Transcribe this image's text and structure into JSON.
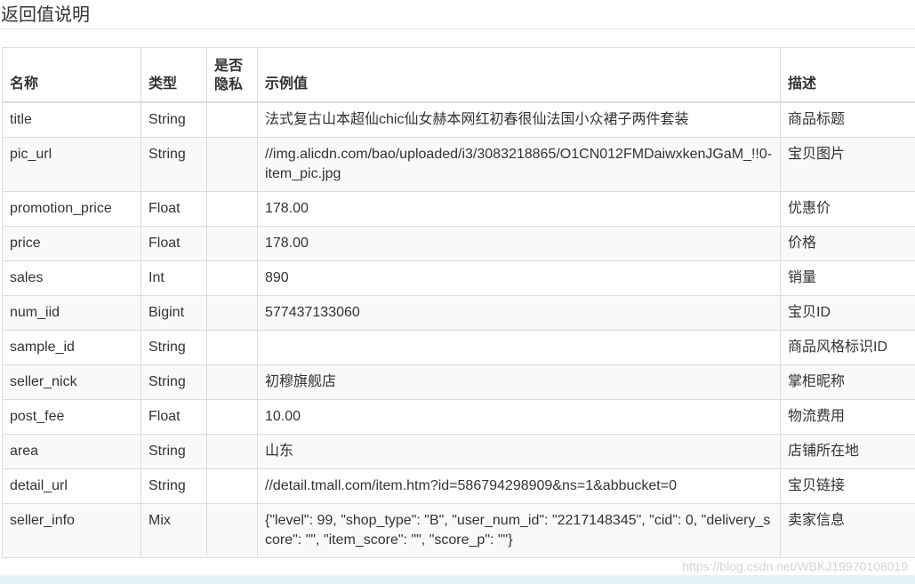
{
  "section_title": "返回值说明",
  "headers": [
    "名称",
    "类型",
    "是否隐私",
    "示例值",
    "描述"
  ],
  "rows": [
    {
      "name": "title",
      "type": "String",
      "privacy": "",
      "example": "法式复古山本超仙chic仙女赫本网红初春很仙法国小众裙子两件套装",
      "desc": "商品标题"
    },
    {
      "name": "pic_url",
      "type": "String",
      "privacy": "",
      "example": "//img.alicdn.com/bao/uploaded/i3/3083218865/O1CN012FMDaiwxkenJGaM_!!0-item_pic.jpg",
      "desc": "宝贝图片"
    },
    {
      "name": "promotion_price",
      "type": "Float",
      "privacy": "",
      "example": "178.00",
      "desc": "优惠价"
    },
    {
      "name": "price",
      "type": "Float",
      "privacy": "",
      "example": "178.00",
      "desc": "价格"
    },
    {
      "name": "sales",
      "type": "Int",
      "privacy": "",
      "example": "890",
      "desc": "销量"
    },
    {
      "name": "num_iid",
      "type": "Bigint",
      "privacy": "",
      "example": "577437133060",
      "desc": "宝贝ID"
    },
    {
      "name": "sample_id",
      "type": "String",
      "privacy": "",
      "example": "",
      "desc": "商品风格标识ID"
    },
    {
      "name": "seller_nick",
      "type": "String",
      "privacy": "",
      "example": "初穆旗舰店",
      "desc": "掌柜昵称"
    },
    {
      "name": "post_fee",
      "type": "Float",
      "privacy": "",
      "example": "10.00",
      "desc": "物流费用"
    },
    {
      "name": "area",
      "type": "String",
      "privacy": "",
      "example": "山东",
      "desc": "店铺所在地"
    },
    {
      "name": "detail_url",
      "type": "String",
      "privacy": "",
      "example": "//detail.tmall.com/item.htm?id=586794298909&ns=1&abbucket=0",
      "desc": "宝贝链接"
    },
    {
      "name": "seller_info",
      "type": "Mix",
      "privacy": "",
      "example": "{\"level\": 99, \"shop_type\": \"B\", \"user_num_id\": \"2217148345\", \"cid\": 0, \"delivery_score\": \"\", \"item_score\": \"\", \"score_p\": \"\"}",
      "desc": "卖家信息"
    }
  ],
  "watermark": "https://blog.csdn.net/WBKJ19970108019"
}
